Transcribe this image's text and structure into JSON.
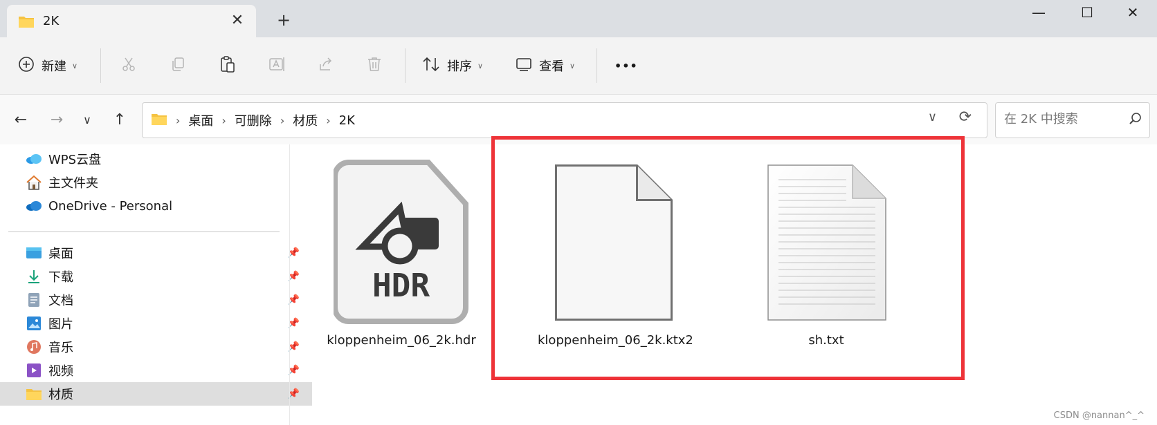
{
  "tab": {
    "title": "2K",
    "close": "✕",
    "new_tab": "+"
  },
  "window": {
    "minimize": "—",
    "maximize": "☐",
    "close": "✕"
  },
  "toolbar": {
    "new_label": "新建",
    "sort_label": "排序",
    "view_label": "查看",
    "more": "•••"
  },
  "breadcrumb": [
    "桌面",
    "可删除",
    "材质",
    "2K"
  ],
  "search": {
    "placeholder": "在 2K 中搜索"
  },
  "sidebar": {
    "top": [
      {
        "label": "WPS云盘",
        "icon": "cloud-icon"
      },
      {
        "label": "主文件夹",
        "icon": "home-icon"
      },
      {
        "label": "OneDrive - Personal",
        "icon": "onedrive-icon"
      }
    ],
    "quick": [
      {
        "label": "桌面",
        "icon": "desktop-icon"
      },
      {
        "label": "下载",
        "icon": "download-icon"
      },
      {
        "label": "文档",
        "icon": "document-icon"
      },
      {
        "label": "图片",
        "icon": "pictures-icon"
      },
      {
        "label": "音乐",
        "icon": "music-icon"
      },
      {
        "label": "视频",
        "icon": "video-icon"
      },
      {
        "label": "材质",
        "icon": "folder-icon"
      }
    ]
  },
  "files": [
    {
      "name": "kloppenheim_06_2k.hdr",
      "icon": "hdr-file-icon",
      "badge": "HDR"
    },
    {
      "name": "kloppenheim_06_2k.ktx2",
      "icon": "blank-file-icon"
    },
    {
      "name": "sh.txt",
      "icon": "text-file-icon"
    }
  ],
  "watermark": "CSDN @nannan^_^",
  "colors": {
    "highlight": "#ee3338",
    "selected_bg": "#dedede",
    "folder": "#f5c342"
  }
}
